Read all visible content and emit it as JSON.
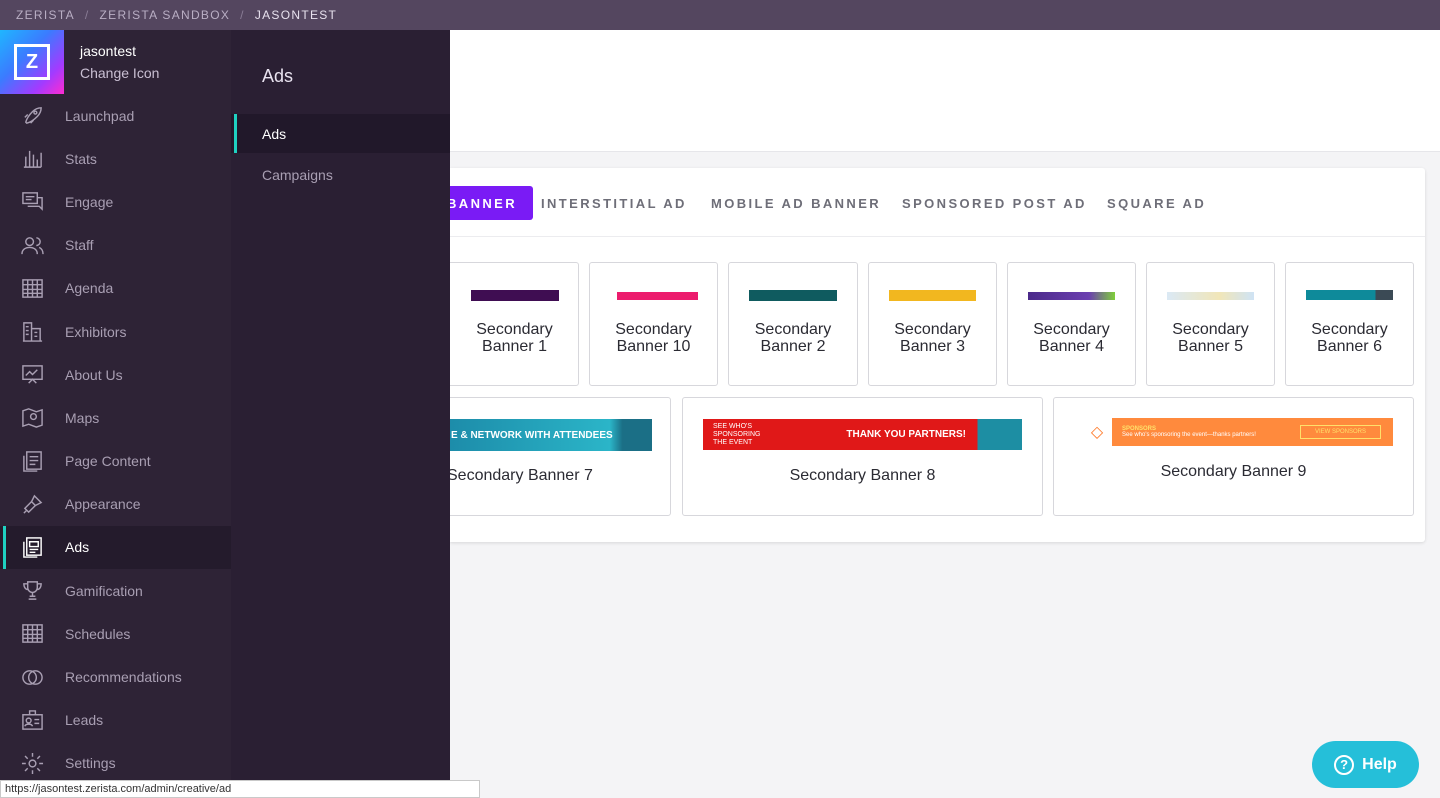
{
  "breadcrumb": [
    "ZERISTA",
    "ZERISTA SANDBOX",
    "JASONTEST"
  ],
  "brand": {
    "logo_letter": "Z",
    "name": "jasontest",
    "sub": "Change Icon"
  },
  "nav": [
    {
      "label": "Launchpad",
      "icon": "rocket-icon"
    },
    {
      "label": "Stats",
      "icon": "bar-chart-icon"
    },
    {
      "label": "Engage",
      "icon": "chat-icon"
    },
    {
      "label": "Staff",
      "icon": "people-icon"
    },
    {
      "label": "Agenda",
      "icon": "calendar-grid-icon"
    },
    {
      "label": "Exhibitors",
      "icon": "building-icon"
    },
    {
      "label": "About Us",
      "icon": "presentation-icon"
    },
    {
      "label": "Maps",
      "icon": "map-icon"
    },
    {
      "label": "Page Content",
      "icon": "pages-icon"
    },
    {
      "label": "Appearance",
      "icon": "paintbrush-icon"
    },
    {
      "label": "Ads",
      "icon": "ads-document-icon"
    },
    {
      "label": "Gamification",
      "icon": "trophy-icon"
    },
    {
      "label": "Schedules",
      "icon": "schedule-grid-icon"
    },
    {
      "label": "Recommendations",
      "icon": "rings-icon"
    },
    {
      "label": "Leads",
      "icon": "badge-icon"
    },
    {
      "label": "Settings",
      "icon": "gear-icon"
    }
  ],
  "nav_active": "Ads",
  "subpanel": {
    "title": "Ads",
    "items": [
      "Ads",
      "Campaigns"
    ]
  },
  "tabs": [
    "BANNER",
    "INTERSTITIAL AD",
    "MOBILE AD BANNER",
    "SPONSORED POST AD",
    "SQUARE AD"
  ],
  "tiles_row1": [
    "Secondary Banner 1",
    "Secondary Banner 10",
    "Secondary Banner 2",
    "Secondary Banner 3",
    "Secondary Banner 4",
    "Secondary Banner 5",
    "Secondary Banner 6"
  ],
  "tiles_row2": [
    {
      "label": "Secondary Banner 7",
      "banner_text": "E & NETWORK WITH ATTENDEES"
    },
    {
      "label": "Secondary Banner 8",
      "banner_left": "SEE WHO'S SPONSORING THE EVENT",
      "banner_right": "THANK YOU PARTNERS!"
    },
    {
      "label": "Secondary Banner 9",
      "banner_title": "SPONSORS",
      "banner_text": "See who's sponsoring the event—thanks partners!",
      "banner_button": "VIEW SPONSORS"
    }
  ],
  "help": {
    "label": "Help",
    "glyph": "?"
  },
  "status_url": "https://jasontest.zerista.com/admin/creative/ad",
  "colors": {
    "accent": "#7a1bf5",
    "active_marker": "#1fd1c1",
    "help": "#25bfd9"
  }
}
